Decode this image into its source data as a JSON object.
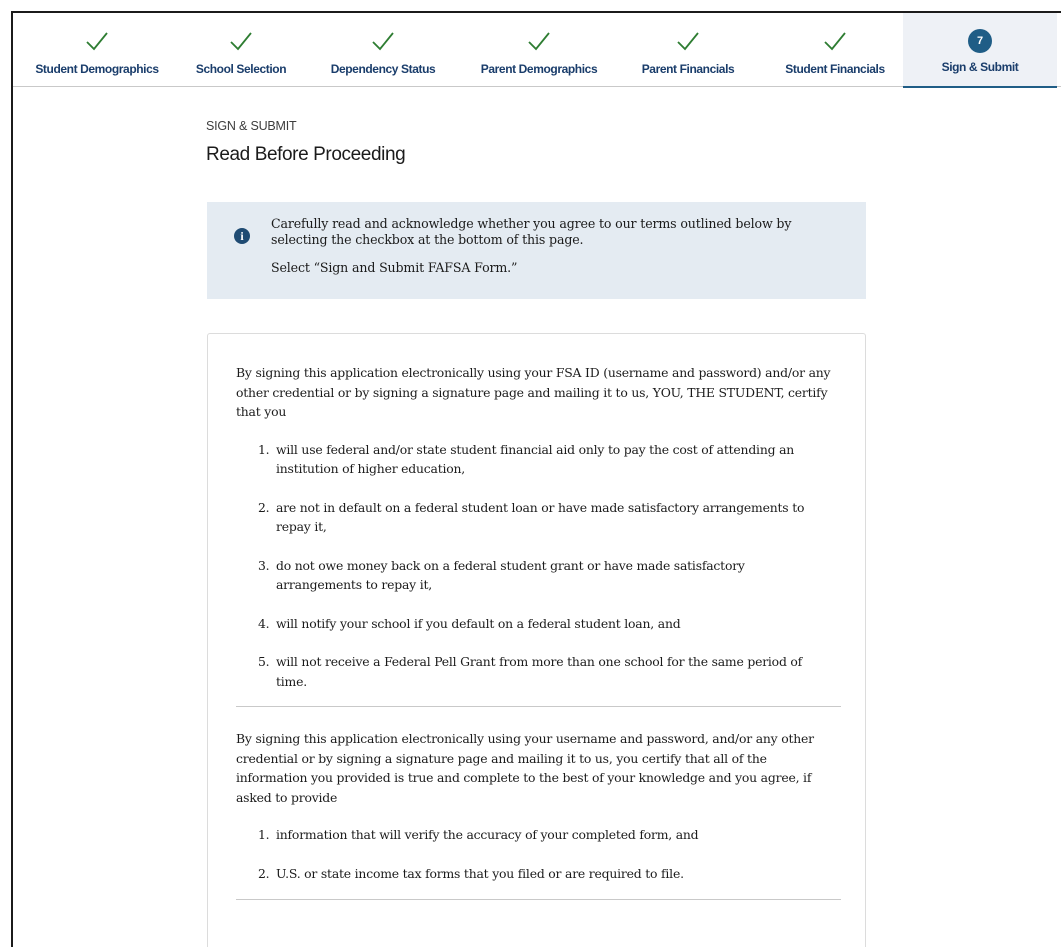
{
  "steps": [
    {
      "label": "Student Demographics",
      "status": "complete"
    },
    {
      "label": "School Selection",
      "status": "complete"
    },
    {
      "label": "Dependency Status",
      "status": "complete"
    },
    {
      "label": "Parent Demographics",
      "status": "complete"
    },
    {
      "label": "Parent Financials",
      "status": "complete"
    },
    {
      "label": "Student Financials",
      "status": "complete"
    },
    {
      "label": "Sign & Submit",
      "status": "current",
      "number": "7"
    }
  ],
  "page": {
    "eyebrow": "SIGN & SUBMIT",
    "title": "Read Before Proceeding"
  },
  "alert": {
    "icon": "info-icon",
    "line1": "Carefully read and acknowledge whether you agree to our terms outlined below by selecting the checkbox at the bottom of this page.",
    "line2": "Select “Sign and Submit FAFSA Form.”"
  },
  "terms": {
    "intro1": "By signing this application electronically using your FSA ID (username and password) and/or any other credential or by signing a signature page and mailing it to us, YOU, THE STUDENT, certify that you",
    "list1": [
      {
        "num": "1.",
        "text": "will use federal and/or state student financial aid only to pay the cost of attending an institution of higher education,"
      },
      {
        "num": "2.",
        "text": "are not in default on a federal student loan or have made satisfactory arrangements to repay it,"
      },
      {
        "num": "3.",
        "text": "do not owe money back on a federal student grant or have made satisfactory arrangements to repay it,"
      },
      {
        "num": "4.",
        "text": "will notify your school if you default on a federal student loan, and"
      },
      {
        "num": "5.",
        "text": "will not receive a Federal Pell Grant from more than one school for the same period of time."
      }
    ],
    "intro2": "By signing this application electronically using your username and password, and/or any other credential or by signing a signature page and mailing it to us, you certify that all of the information you provided is true and complete to the best of your knowledge and you agree, if asked to provide",
    "list2": [
      {
        "num": "1.",
        "text": "information that will verify the accuracy of your completed form, and"
      },
      {
        "num": "2.",
        "text": "U.S. or state income tax forms that you filed or are required to file."
      }
    ]
  },
  "colors": {
    "check": "#2e7d32",
    "step_label": "#1a3d6b",
    "active_badge": "#1f5d86",
    "alert_bg": "#e4ebf2"
  }
}
